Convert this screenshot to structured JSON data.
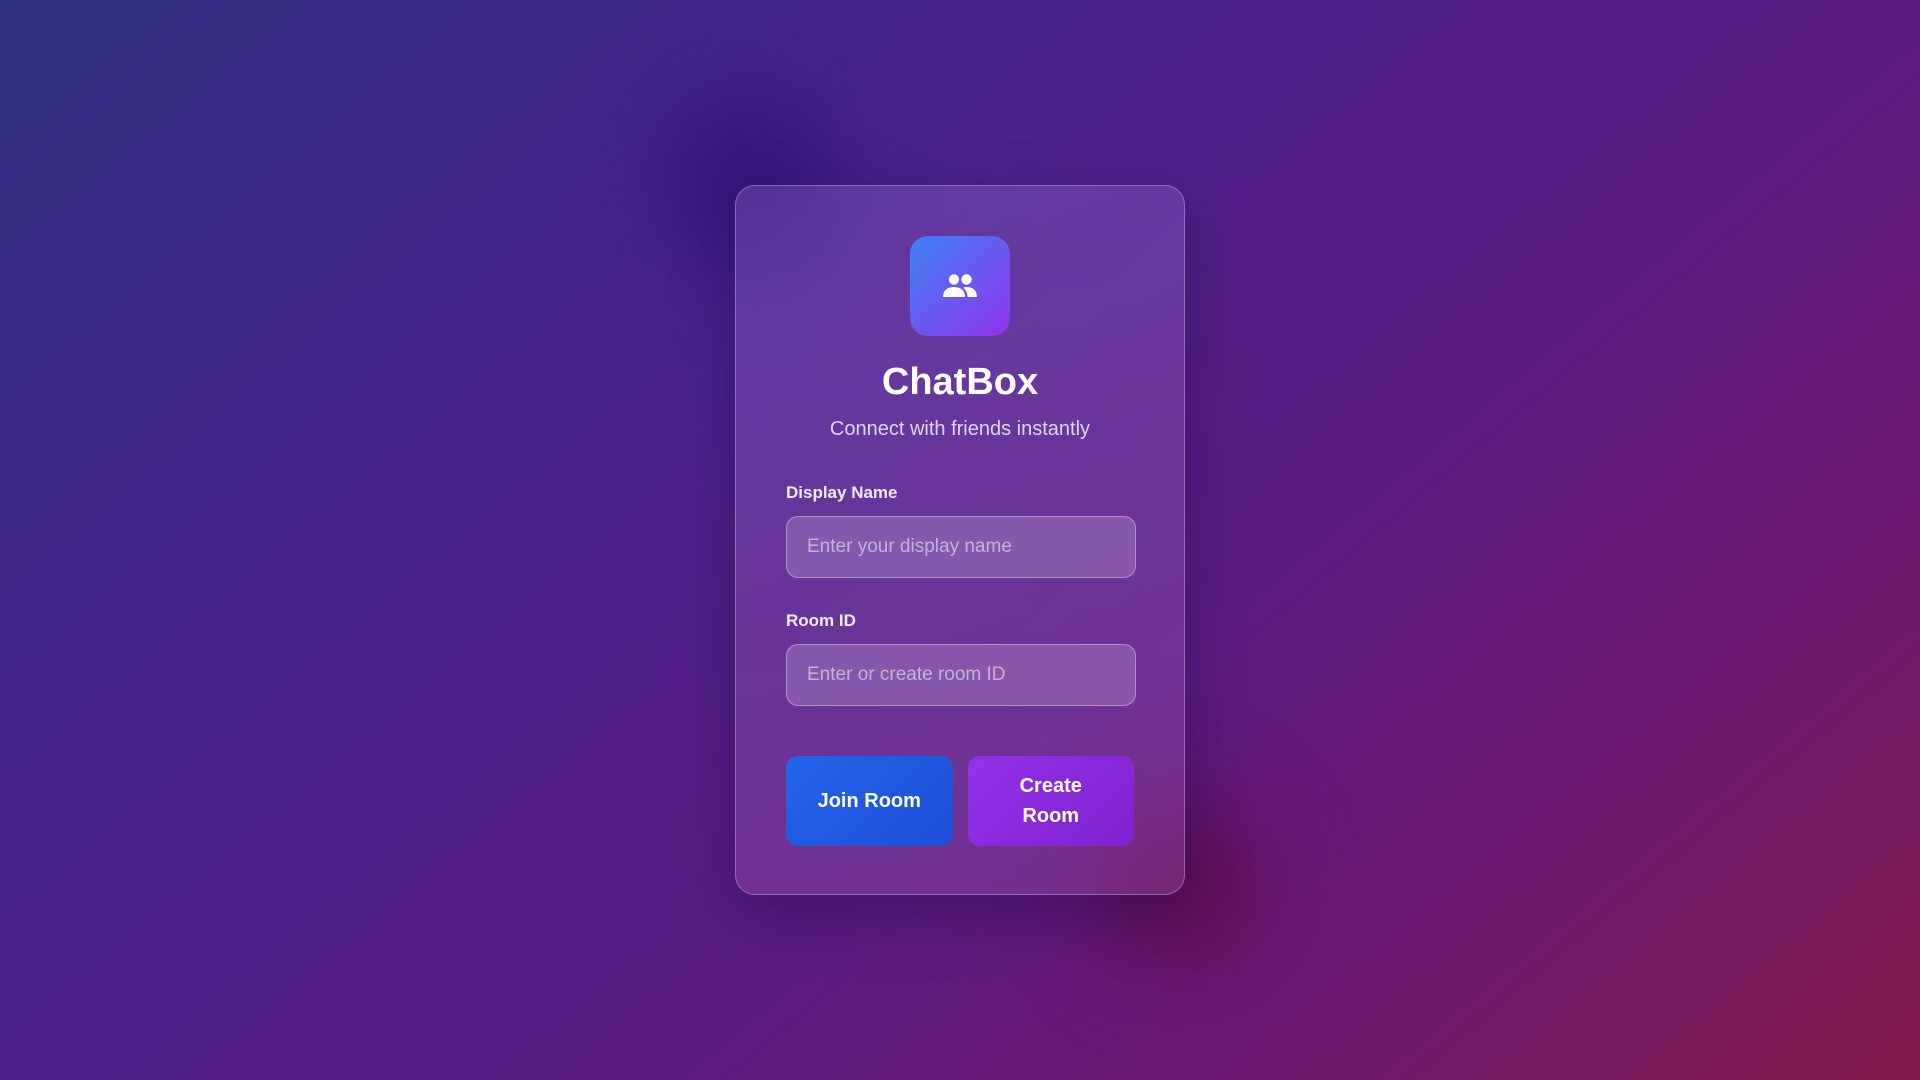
{
  "app": {
    "title": "ChatBox",
    "subtitle": "Connect with friends instantly",
    "logo_icon": "users-icon"
  },
  "form": {
    "display_name": {
      "label": "Display Name",
      "placeholder": "Enter your display name",
      "value": ""
    },
    "room_id": {
      "label": "Room ID",
      "placeholder": "Enter or create room ID",
      "value": ""
    }
  },
  "actions": {
    "join_label": "Join Room",
    "create_label": "Create Room"
  },
  "colors": {
    "accent_blue": "#2563eb",
    "accent_purple": "#9333ea"
  }
}
